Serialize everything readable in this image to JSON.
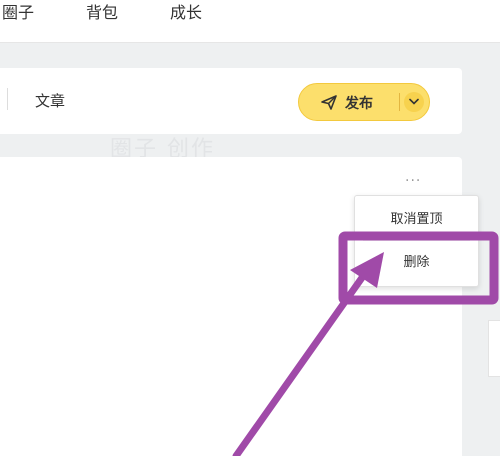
{
  "nav": {
    "items": [
      "圈子",
      "背包",
      "成长"
    ]
  },
  "composer": {
    "tab_label": "文章",
    "publish_label": "发布"
  },
  "post": {
    "more_label": "···",
    "menu": {
      "unpin_label": "取消置顶",
      "delete_label": "删除"
    }
  },
  "background_text": "圈子 创作",
  "colors": {
    "publish_bg": "#fcdf6c",
    "annotation": "#a04aa8",
    "canvas_bg": "#eef0f1"
  },
  "icons": [
    "paper-plane-icon",
    "chevron-down-icon",
    "more-icon"
  ]
}
